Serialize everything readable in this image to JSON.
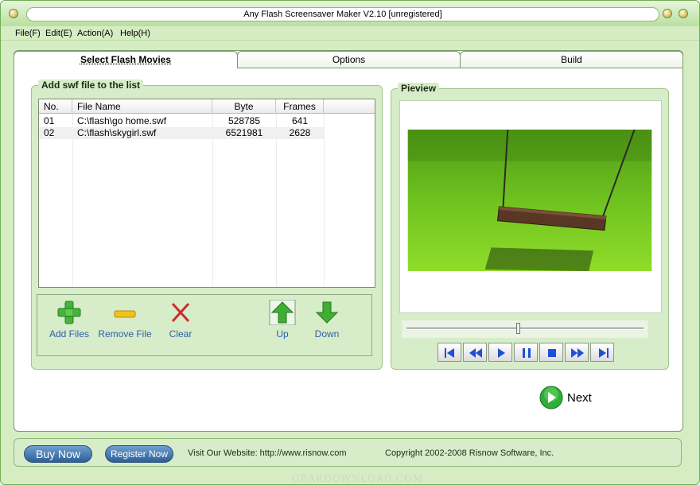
{
  "window": {
    "title": "Any Flash Screensaver Maker V2.10 [unregistered]"
  },
  "menu": [
    {
      "label": "File(F)"
    },
    {
      "label": "Edit(E)"
    },
    {
      "label": "Action(A)"
    },
    {
      "label": "Help(H)"
    }
  ],
  "tabs": [
    {
      "label": "Select Flash Movies",
      "active": true
    },
    {
      "label": "Options",
      "active": false
    },
    {
      "label": "Build",
      "active": false
    }
  ],
  "file_group": {
    "title": "Add swf file to the list",
    "columns": [
      "No.",
      "File Name",
      "Byte",
      "Frames"
    ],
    "rows": [
      {
        "no": "01",
        "file": "C:\\flash\\go home.swf",
        "byte": "528785",
        "frames": "641"
      },
      {
        "no": "02",
        "file": "C:\\flash\\skygirl.swf",
        "byte": "6521981",
        "frames": "2628"
      }
    ]
  },
  "tools": {
    "add": "Add Files",
    "remove": "Remove File",
    "clear": "Clear",
    "up": "Up",
    "down": "Down"
  },
  "preview": {
    "title": "Pieview",
    "position": 0.47
  },
  "next_label": "Next",
  "footer": {
    "buy": "Buy Now",
    "register": "Register Now",
    "website": "Visit Our Website: http://www.risnow.com",
    "copyright": "Copyright 2002-2008 Risnow Software, Inc."
  },
  "watermark": "GEARDOWNLOAD.COM",
  "colors": {
    "accent_green": "#d6edc4",
    "link_blue": "#2f5fa8",
    "button_blue": "#2d5f96"
  }
}
